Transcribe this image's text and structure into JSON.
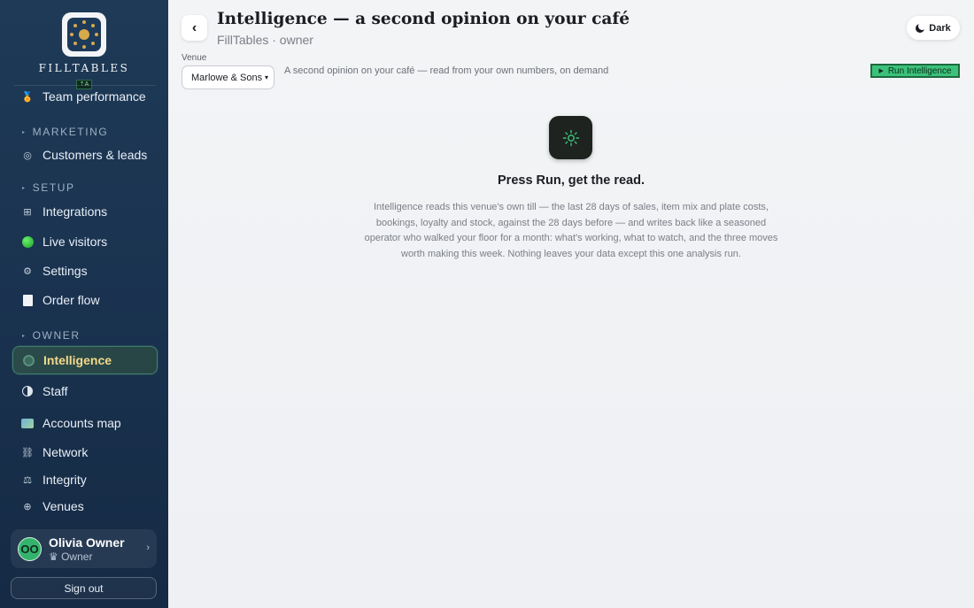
{
  "sidebar": {
    "brand": "FILLTABLES",
    "brand_badge": "⇡A",
    "items_top": [
      {
        "label": "Team performance",
        "icon": "medal-icon"
      }
    ],
    "sections": {
      "marketing": "MARKETING",
      "setup": "SETUP",
      "owner": "OWNER"
    },
    "marketing_items": [
      {
        "label": "Customers & leads",
        "icon": "target-icon"
      }
    ],
    "setup_items": [
      {
        "label": "Integrations",
        "icon": "grid-icon"
      },
      {
        "label": "Live visitors",
        "icon": "green-dot-icon"
      },
      {
        "label": "Settings",
        "icon": "gear-icon"
      },
      {
        "label": "Order flow",
        "icon": "page-icon"
      }
    ],
    "owner_items": [
      {
        "label": "Intelligence",
        "icon": "gear-ring-icon",
        "active": true
      },
      {
        "label": "Staff",
        "icon": "half-circle-icon"
      },
      {
        "label": "Accounts map",
        "icon": "map-icon"
      },
      {
        "label": "Network",
        "icon": "link-icon"
      },
      {
        "label": "Integrity",
        "icon": "scales-icon"
      },
      {
        "label": "Venues",
        "icon": "plus-circle-icon"
      }
    ],
    "user": {
      "initials": "OO",
      "name": "Olivia Owner",
      "role": "♛ Owner"
    },
    "sign_out": "Sign out"
  },
  "header": {
    "title": "Intelligence — a second opinion on your café",
    "subtitle": "FillTables · owner",
    "dark_label": "Dark"
  },
  "toolbar": {
    "venue_label": "Venue",
    "venue_value": "Marlowe & Sons",
    "description": "A second opinion on your café — read from your own numbers, on demand",
    "run_label": "Run Intelligence"
  },
  "empty_state": {
    "title": "Press Run, get the read.",
    "body": "Intelligence reads this venue's own till — the last 28 days of sales, item mix and plate costs, bookings, loyalty and stock, against the 28 days before — and writes back like a seasoned operator who walked your floor for a month: what's working, what to watch, and the three moves worth making this week. Nothing leaves your data except this one analysis run."
  },
  "colors": {
    "sidebar_bg": "#1a3350",
    "accent_green": "#3cc17a",
    "active_text": "#f3d98a",
    "brand_gold": "#d8a94a"
  }
}
